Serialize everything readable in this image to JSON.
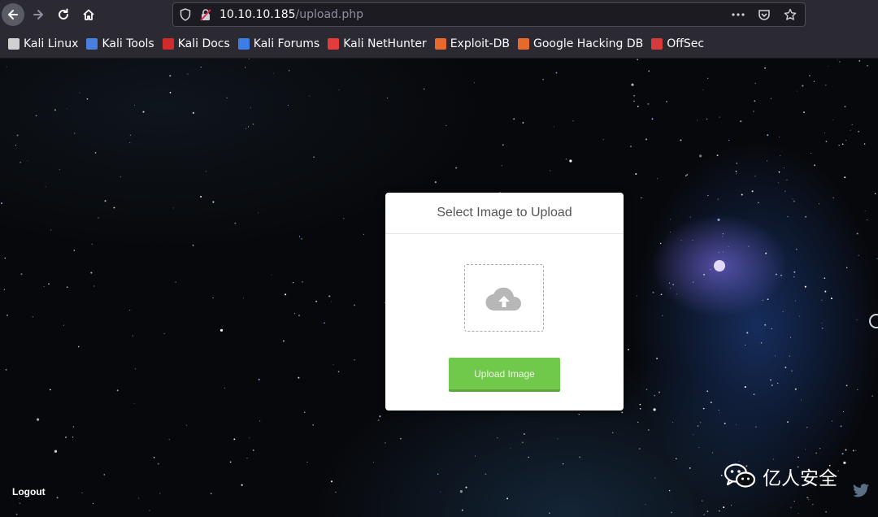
{
  "browser": {
    "url_host": "10.10.10.185",
    "url_path": "/upload.php",
    "bookmarks": [
      {
        "label": "Kali Linux",
        "icon": "kali-dragon-icon",
        "color": "#d0d0d0"
      },
      {
        "label": "Kali Tools",
        "icon": "kali-tools-icon",
        "color": "#4a7fe0"
      },
      {
        "label": "Kali Docs",
        "icon": "kali-docs-icon",
        "color": "#d02a2a"
      },
      {
        "label": "Kali Forums",
        "icon": "kali-forums-icon",
        "color": "#3c7ee6"
      },
      {
        "label": "Kali NetHunter",
        "icon": "nethunter-icon",
        "color": "#e23c3c"
      },
      {
        "label": "Exploit-DB",
        "icon": "exploit-db-icon",
        "color": "#e8692c"
      },
      {
        "label": "Google Hacking DB",
        "icon": "ghdb-icon",
        "color": "#e8692c"
      },
      {
        "label": "OffSec",
        "icon": "offsec-icon",
        "color": "#d63b3b"
      }
    ]
  },
  "upload": {
    "title": "Select Image to Upload",
    "button_label": "Upload Image",
    "button_color": "#71c94b"
  },
  "footer": {
    "logout_label": "Logout",
    "watermark_text": "亿人安全"
  }
}
